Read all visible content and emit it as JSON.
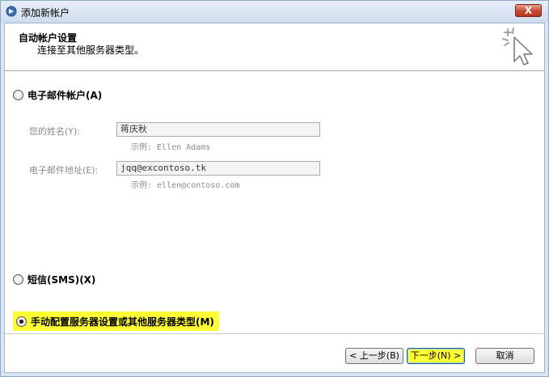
{
  "window": {
    "title": "添加新帐户",
    "close_symbol": "X"
  },
  "header": {
    "title": "自动帐户设置",
    "subtitle": "连接至其他服务器类型。",
    "icon": "wizard-cursor-sparkle-icon"
  },
  "options": {
    "email": {
      "label": "电子邮件帐户(A)",
      "checked": false
    },
    "sms": {
      "label": "短信(SMS)(X)",
      "checked": false
    },
    "manual": {
      "label": "手动配置服务器设置或其他服务器类型(M)",
      "checked": true,
      "highlight_color": "#ffff33"
    }
  },
  "form": {
    "name": {
      "label": "您的姓名(Y):",
      "value": "蒋庆秋",
      "example": "示例: Ellen Adams"
    },
    "email": {
      "label": "电子邮件地址(E):",
      "value": "jqq@excontoso.tk",
      "example": "示例: ellen@contoso.com"
    }
  },
  "buttons": {
    "back": "< 上一步(B)",
    "next": "下一步(N) >",
    "cancel": "取消"
  }
}
